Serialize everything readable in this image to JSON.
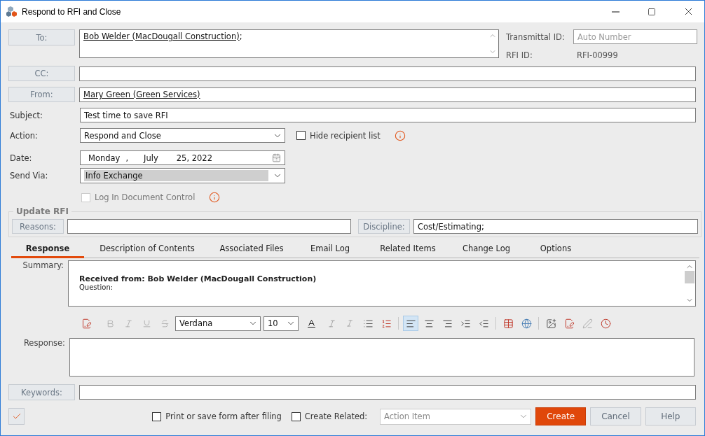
{
  "window": {
    "title": "Respond to RFI and Close"
  },
  "recipients": [
    {
      "kind": "to",
      "label": "To:",
      "value": "Bob Welder (MacDougall Construction)",
      "trailing": ";"
    },
    {
      "kind": "cc",
      "label": "CC:"
    },
    {
      "kind": "from",
      "label": "From:",
      "value": "Mary Green (Green Services)"
    }
  ],
  "transmittal": {
    "label": "Transmittal ID:",
    "placeholder": "Auto Number"
  },
  "rfi_id": {
    "label": "RFI ID:",
    "value": "RFI-00999"
  },
  "subject": {
    "label": "Subject:",
    "value": "Test time to save RFI"
  },
  "action": {
    "label": "Action:",
    "value": "Respond and Close"
  },
  "hide_recipient_list": {
    "label": "Hide recipient list",
    "checked": false
  },
  "date": {
    "label": "Date:",
    "weekday": "Monday",
    "separator": ",",
    "month": "July",
    "day_year": "25, 2022"
  },
  "send_via": {
    "label": "Send Via:",
    "value": "Info Exchange"
  },
  "log_in_document_control": {
    "label": "Log In Document Control",
    "checked": false,
    "disabled": true
  },
  "update_rfi": {
    "title": "Update RFI",
    "reasons": {
      "label": "Reasons:"
    },
    "discipline": {
      "label": "Discipline:",
      "value": "Cost/Estimating;"
    }
  },
  "tabs": [
    {
      "label": "Response",
      "selected": true
    },
    {
      "label": "Description of Contents",
      "selected": false
    },
    {
      "label": "Associated Files",
      "selected": false
    },
    {
      "label": "Email Log",
      "selected": false
    },
    {
      "label": "Related Items",
      "selected": false
    },
    {
      "label": "Change Log",
      "selected": false
    },
    {
      "label": "Options",
      "selected": false
    }
  ],
  "summary": {
    "label": "Summary:",
    "heading": "Received from: Bob Welder (MacDougall Construction)",
    "body": "Question:"
  },
  "editor_toolbar": {
    "font": "Verdana",
    "size": "10",
    "paragraph_buttons": [
      {
        "selected": true
      },
      {
        "selected": false
      },
      {
        "selected": false
      },
      {
        "selected": false
      },
      {
        "selected": false
      }
    ]
  },
  "response": {
    "label": "Response:"
  },
  "keywords": {
    "label": "Keywords:"
  },
  "footer": {
    "print_after_filing": {
      "label": "Print or save form after filing",
      "checked": false
    },
    "create_related": {
      "label": "Create Related:",
      "checked": false
    },
    "related_type": {
      "value": "Action Item",
      "disabled": true
    },
    "buttons": [
      {
        "label": "Create",
        "kind": "primary"
      },
      {
        "label": "Cancel",
        "kind": "normal"
      },
      {
        "label": "Help",
        "kind": "normal"
      }
    ]
  }
}
